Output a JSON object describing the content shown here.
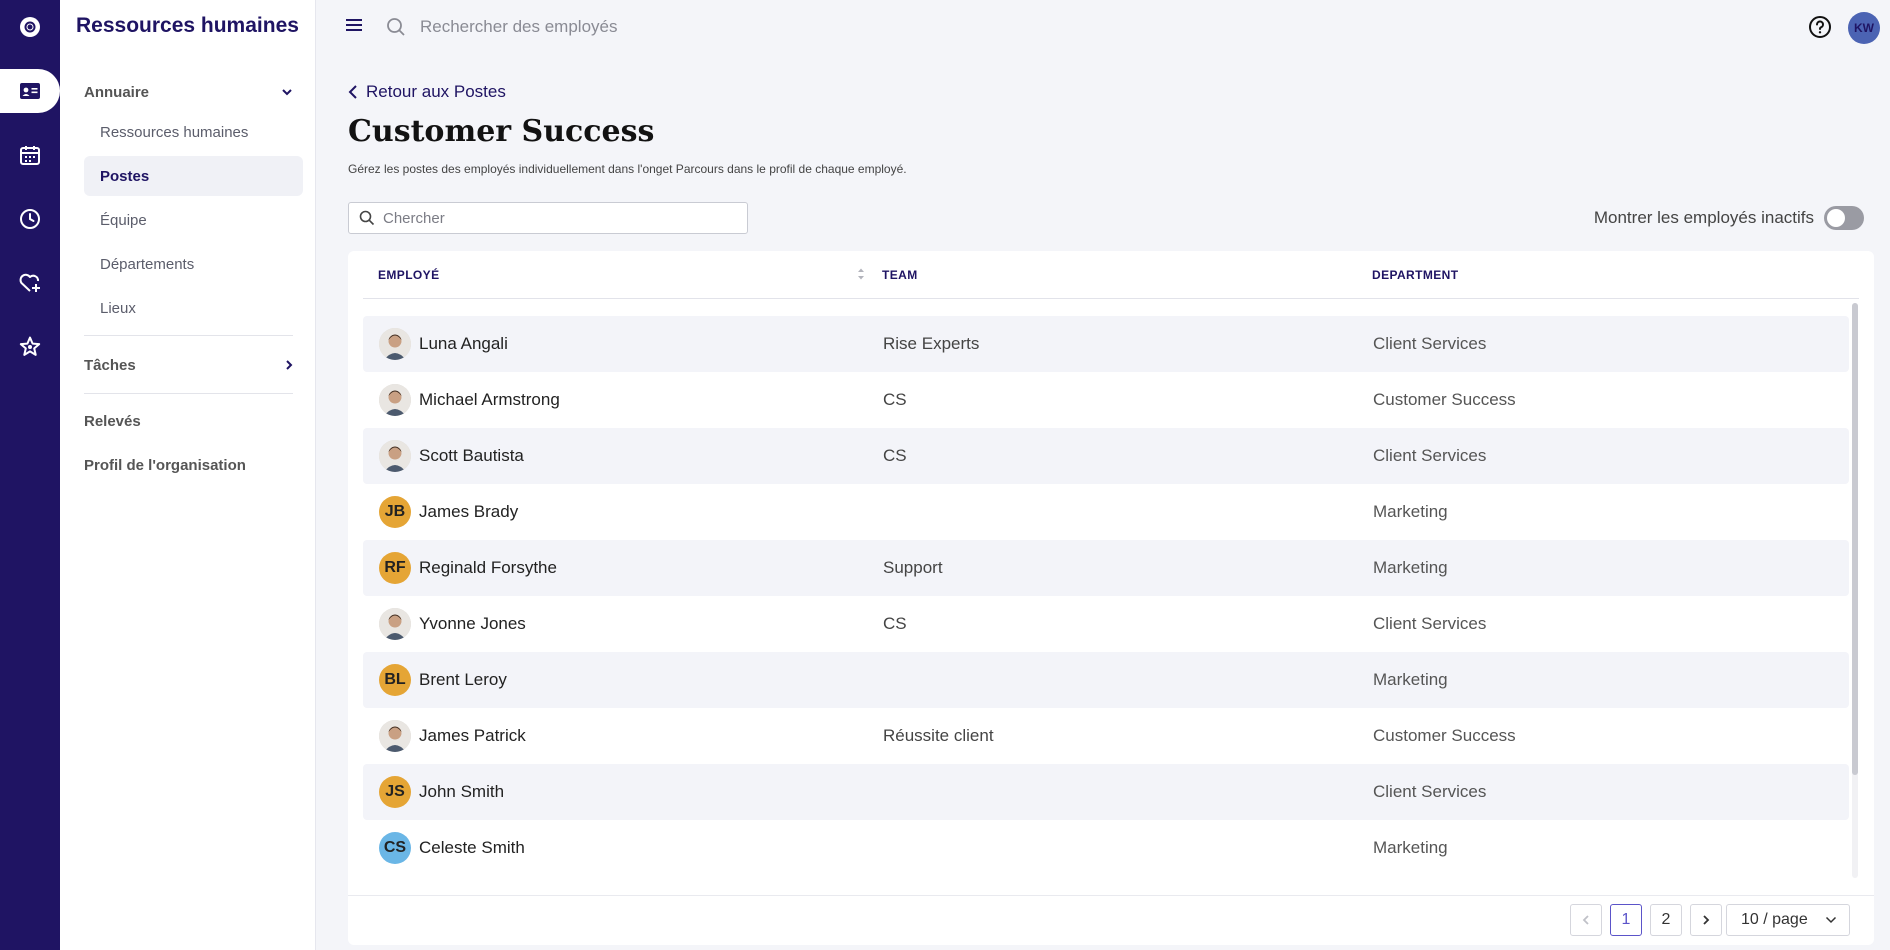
{
  "sidebar": {
    "title": "Ressources humaines",
    "groups": {
      "annuaire": "Annuaire",
      "taches": "Tâches",
      "releves": "Relevés",
      "profil": "Profil de l'organisation"
    },
    "items": [
      {
        "label": "Ressources humaines"
      },
      {
        "label": "Postes"
      },
      {
        "label": "Équipe"
      },
      {
        "label": "Départements"
      },
      {
        "label": "Lieux"
      }
    ]
  },
  "topbar": {
    "search_placeholder": "Rechercher des employés",
    "avatar_initials": "KW"
  },
  "main": {
    "back_label": "Retour aux Postes",
    "title": "Customer Success",
    "description": "Gérez les postes des employés individuellement dans l'onget Parcours dans le profil de chaque employé.",
    "search_placeholder": "Chercher",
    "toggle_label": "Montrer les employés inactifs"
  },
  "table": {
    "headers": {
      "employee": "EMPLOYÉ",
      "team": "TEAM",
      "department": "DEPARTMENT"
    },
    "rows": [
      {
        "name": "Luna Angali",
        "team": "Rise Experts",
        "department": "Client Services",
        "avatar": "photo",
        "initials": ""
      },
      {
        "name": "Michael Armstrong",
        "team": "CS",
        "department": "Customer Success",
        "avatar": "photo",
        "initials": ""
      },
      {
        "name": "Scott Bautista",
        "team": "CS",
        "department": "Client Services",
        "avatar": "photo",
        "initials": ""
      },
      {
        "name": "James Brady",
        "team": "",
        "department": "Marketing",
        "avatar": "orange",
        "initials": "JB"
      },
      {
        "name": "Reginald Forsythe",
        "team": "Support",
        "department": "Marketing",
        "avatar": "orange",
        "initials": "RF"
      },
      {
        "name": "Yvonne Jones",
        "team": "CS",
        "department": "Client Services",
        "avatar": "photo",
        "initials": ""
      },
      {
        "name": "Brent Leroy",
        "team": "",
        "department": "Marketing",
        "avatar": "orange",
        "initials": "BL"
      },
      {
        "name": "James Patrick",
        "team": "Réussite client",
        "department": "Customer Success",
        "avatar": "photo",
        "initials": ""
      },
      {
        "name": "John Smith",
        "team": "",
        "department": "Client Services",
        "avatar": "orange",
        "initials": "JS"
      },
      {
        "name": "Celeste Smith",
        "team": "",
        "department": "Marketing",
        "avatar": "blue",
        "initials": "CS"
      }
    ]
  },
  "pagination": {
    "pages": [
      "1",
      "2"
    ],
    "current": "1",
    "per_page": "10 / page"
  },
  "colors": {
    "brand": "#1f1463",
    "orange_avatar": "#e5a535",
    "blue_avatar": "#6ab6e6"
  }
}
